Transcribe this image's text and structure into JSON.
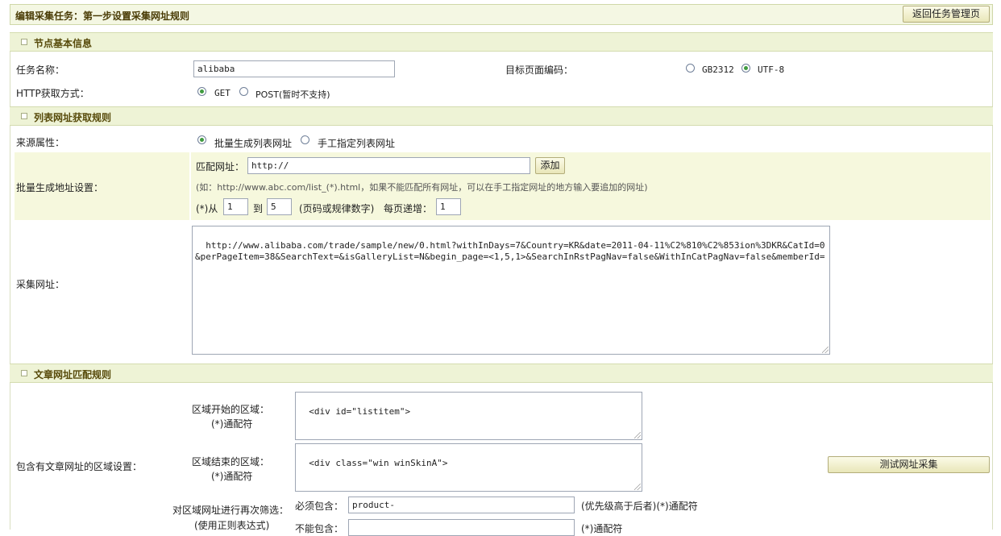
{
  "header": {
    "title": "编辑采集任务：第一步设置采集网址规则",
    "back_button": "返回任务管理页"
  },
  "sections": {
    "basic": "节点基本信息",
    "list_rules": "列表网址获取规则",
    "article_rules": "文章网址匹配规则"
  },
  "basic": {
    "task_name_label": "任务名称：",
    "task_name_value": "alibaba",
    "encoding_label": "目标页面编码：",
    "encoding_options": [
      "GB2312",
      "UTF-8"
    ],
    "encoding_selected": "UTF-8",
    "http_label": "HTTP获取方式：",
    "http_options": [
      "GET",
      "POST(暂时不支持)"
    ],
    "http_selected": "GET"
  },
  "list_rules": {
    "source_label": "来源属性：",
    "source_options": [
      "批量生成列表网址",
      "手工指定列表网址"
    ],
    "source_selected": "批量生成列表网址",
    "batch_label": "批量生成地址设置：",
    "match_url_label": "匹配网址：",
    "match_url_value": "http://",
    "add_button": "添加",
    "hint": "(如：http://www.abc.com/list_(*).html，如果不能匹配所有网址，可以在手工指定网址的地方输入要追加的网址)",
    "from_label": "(*)从",
    "from_value": "1",
    "to_label": "到",
    "to_value": "5",
    "page_hint": "(页码或规律数字)",
    "step_label": "每页递增：",
    "step_value": "1",
    "collect_label": "采集网址：",
    "collect_value": "http://www.alibaba.com/trade/sample/new/0.html?withInDays=7&Country=KR&date=2011-04-11%C2%810%C2%853ion%3DKR&CatId=0&perPageItem=38&SearchText=&isGalleryList=N&begin_page=<1,5,1>&SearchInRstPagNav=false&WithInCatPagNav=false&memberId="
  },
  "article_rules": {
    "area_label": "包含有文章网址的区域设置：",
    "start_label": "区域开始的区域：",
    "start_wild": "(*)通配符",
    "start_value": "<div id=\"listitem\">",
    "end_label": "区域结束的区域：",
    "end_wild": "(*)通配符",
    "end_value": "<div class=\"win winSkinA\">",
    "test_button": "测试网址采集",
    "filter_label": "对区域网址进行再次筛选：",
    "filter_sub": "(使用正则表达式)",
    "must_label": "必须包含：",
    "must_value": "product-",
    "must_hint": "(优先级高于后者)(*)通配符",
    "cannot_label": "不能包含：",
    "cannot_value": "",
    "cannot_hint": "(*)通配符"
  }
}
